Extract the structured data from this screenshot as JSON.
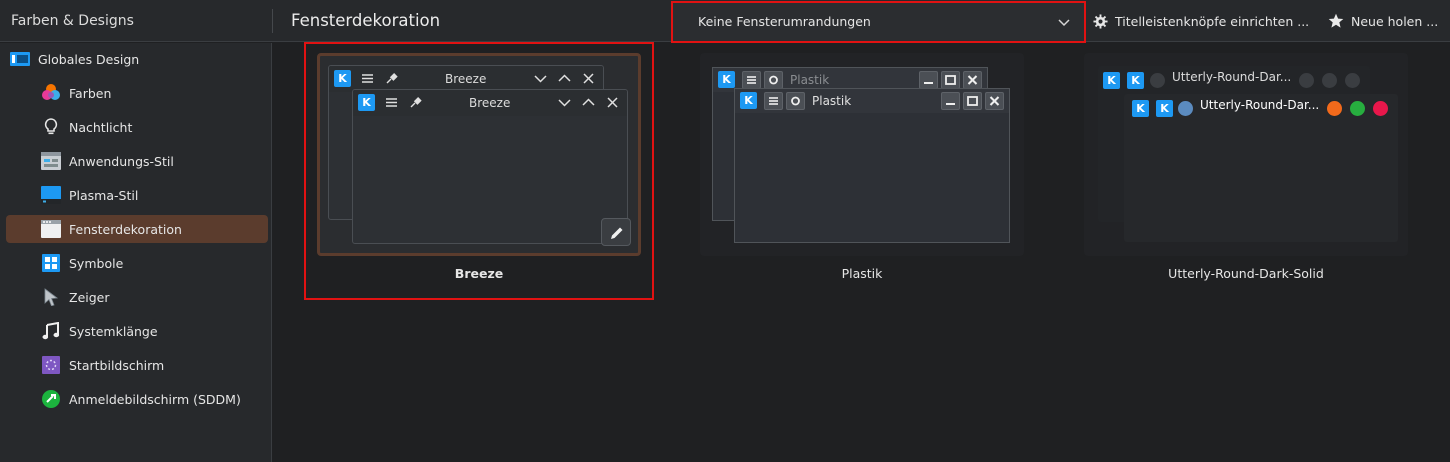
{
  "app": {
    "title": "Farben & Designs"
  },
  "page": {
    "title": "Fensterdekoration"
  },
  "border_combo": {
    "value": "Keine Fensterumrandungen"
  },
  "toolbar": {
    "titlebar_buttons_label": "Titelleistenknöpfe einrichten ...",
    "get_new_label": "Neue holen ..."
  },
  "sidebar": {
    "global": {
      "label": "Globales Design",
      "icon": "global-theme-icon"
    },
    "items": [
      {
        "label": "Farben",
        "icon": "colors-icon"
      },
      {
        "label": "Nachtlicht",
        "icon": "night-light-icon"
      },
      {
        "label": "Anwendungs-Stil",
        "icon": "application-style-icon"
      },
      {
        "label": "Plasma-Stil",
        "icon": "plasma-style-icon"
      },
      {
        "label": "Fensterdekoration",
        "icon": "window-decoration-icon",
        "selected": true
      },
      {
        "label": "Symbole",
        "icon": "icons-icon"
      },
      {
        "label": "Zeiger",
        "icon": "cursor-icon"
      },
      {
        "label": "Systemklänge",
        "icon": "system-sounds-icon"
      },
      {
        "label": "Startbildschirm",
        "icon": "splash-screen-icon"
      },
      {
        "label": "Anmeldebildschirm (SDDM)",
        "icon": "login-screen-icon"
      }
    ]
  },
  "decorations": [
    {
      "name": "Breeze",
      "window_title": "Breeze",
      "selected": true
    },
    {
      "name": "Plastik",
      "window_title": "Plastik",
      "selected": false
    },
    {
      "name": "Utterly-Round-Dark-Solid",
      "window_title": "Utterly-Round-Dar...",
      "selected": false
    }
  ],
  "colors": {
    "accent_selection": "#5b3c2d",
    "highlight_outline": "#e11212",
    "kde_blue": "#1d99f3",
    "ur_minimize": "#f26a1b",
    "ur_maximize": "#27ae3f",
    "ur_close": "#e8174b"
  }
}
